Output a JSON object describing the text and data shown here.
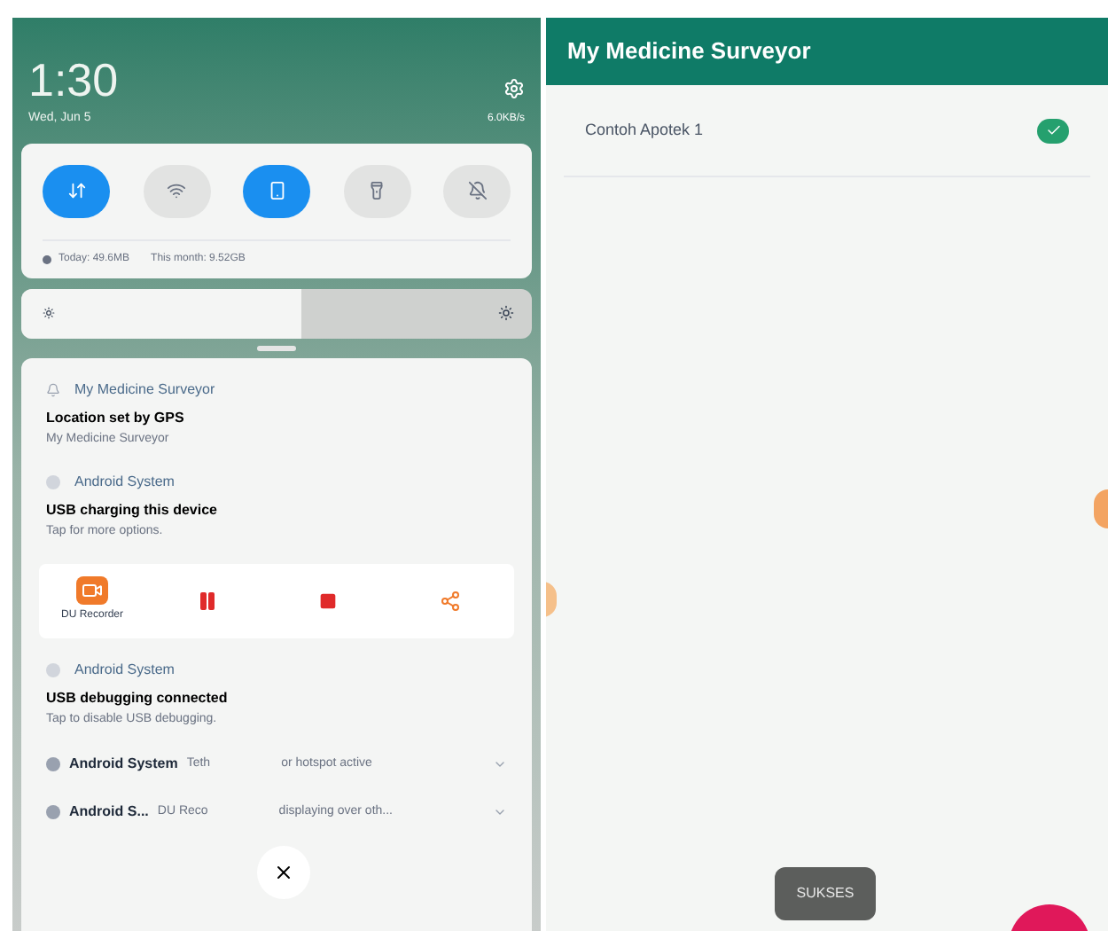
{
  "shade": {
    "time": "1:30",
    "date": "Wed, Jun 5",
    "status": "6.0KB/s",
    "toggles": [
      {
        "selected": true
      },
      {
        "selected": false
      },
      {
        "selected": true
      },
      {
        "selected": false
      },
      {
        "selected": false
      }
    ],
    "data_today": "Today: 49.6MB",
    "data_month": "This month: 9.52GB",
    "brightness": {
      "level": 0.55
    },
    "notifications": [
      {
        "kind": "full",
        "app": "My Medicine Surveyor",
        "title": "Location set by GPS",
        "body": "My Medicine Surveyor"
      },
      {
        "kind": "full",
        "app": "Android System",
        "title": "USB charging this device",
        "body": "Tap for more options."
      },
      {
        "kind": "recorder",
        "label": "DU Recorder"
      },
      {
        "kind": "full",
        "app": "Android System",
        "title": "USB debugging connected",
        "body": "Tap to disable USB debugging."
      },
      {
        "kind": "collapsed",
        "app": "Android System",
        "text_before": "Teth",
        "text_after": "or hotspot active"
      },
      {
        "kind": "collapsed",
        "app": "Android S...",
        "text_before": "DU Reco",
        "text_after": "displaying over oth..."
      }
    ]
  },
  "app": {
    "title": "My Medicine Surveyor",
    "items": [
      {
        "name": "Contoh Apotek 1",
        "checked": true
      }
    ],
    "toast": "SUKSES"
  }
}
